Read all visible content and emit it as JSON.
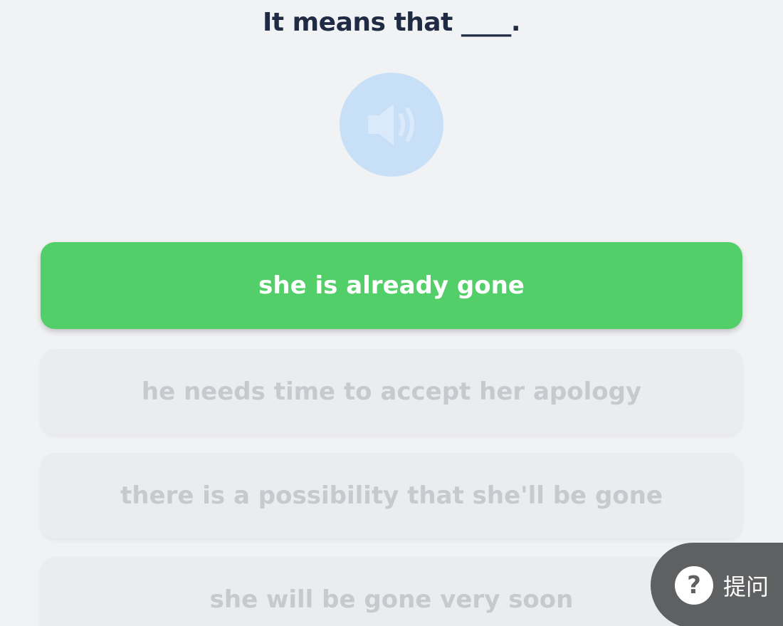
{
  "question": {
    "text": "It means that ____."
  },
  "audio": {
    "icon": "speaker-icon",
    "color": "#c8e0f7"
  },
  "options": [
    {
      "label": "she is already gone",
      "state": "selected",
      "color": "#53cf69"
    },
    {
      "label": "he needs time to accept her apology",
      "state": "disabled"
    },
    {
      "label": "there is a possibility that she'll be gone",
      "state": "disabled"
    },
    {
      "label": "she will be gone very soon",
      "state": "disabled"
    }
  ],
  "help": {
    "icon_text": "?",
    "label": "提问",
    "color": "#5e6062"
  }
}
